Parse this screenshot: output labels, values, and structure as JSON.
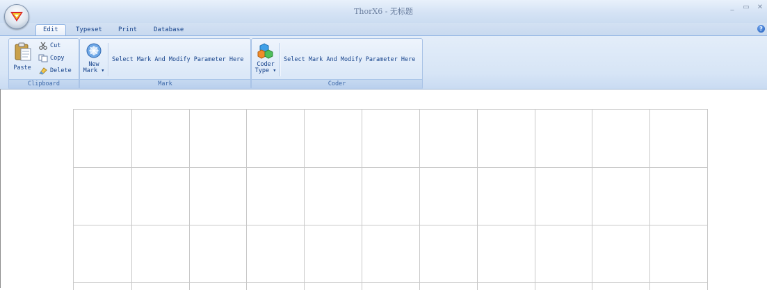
{
  "window": {
    "title": "ThorX6 - 无标题",
    "controls": {
      "minimize": "_",
      "maximize": "▭",
      "close": "✕"
    }
  },
  "tabs": [
    {
      "label": "Edit",
      "active": true
    },
    {
      "label": "Typeset",
      "active": false
    },
    {
      "label": "Print",
      "active": false
    },
    {
      "label": "Database",
      "active": false
    }
  ],
  "help": {
    "glyph": "?"
  },
  "ribbon": {
    "clipboard": {
      "label": "Clipboard",
      "paste": "Paste",
      "cut": "Cut",
      "copy": "Copy",
      "delete": "Delete"
    },
    "mark": {
      "label": "Mark",
      "new_mark_line1": "New",
      "new_mark_line2": "Mark",
      "hint": "Select Mark And Modify Parameter Here"
    },
    "coder": {
      "label": "Coder",
      "coder_type_line1": "Coder",
      "coder_type_line2": "Type",
      "hint": "Select Mark And Modify Parameter Here"
    }
  },
  "colors": {
    "ribbon_text": "#15428b",
    "grid_line": "#c8c8c8",
    "accent": "#8db2e3"
  }
}
